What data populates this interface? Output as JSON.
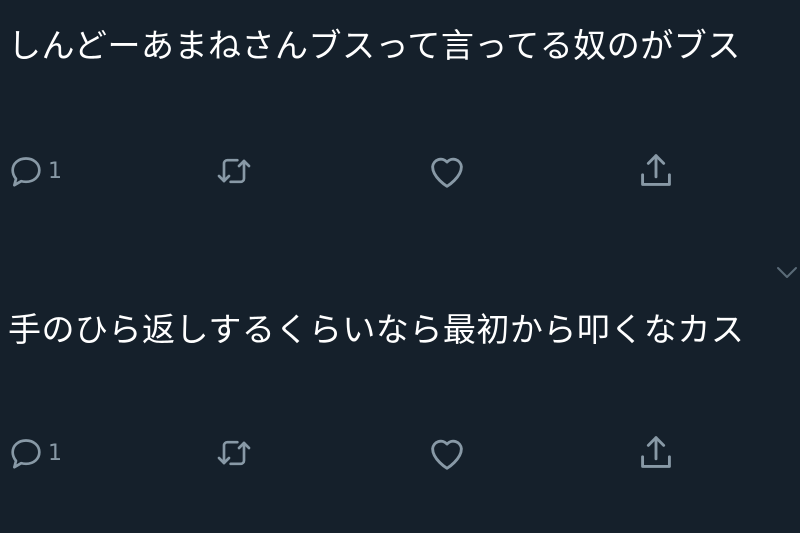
{
  "tweets": [
    {
      "text": "しんどーあまねさんブスって言ってる奴のがブス",
      "reply_count": "1"
    },
    {
      "text": "手のひら返しするくらいなら最初から叩くなカス",
      "reply_count": "1"
    }
  ],
  "icons": {
    "reply": "reply-icon",
    "retweet": "retweet-icon",
    "like": "heart-icon",
    "share": "share-icon",
    "caret": "chevron-down-icon"
  },
  "colors": {
    "background": "#15202b",
    "text": "#ffffff",
    "icon": "#8899a6"
  }
}
